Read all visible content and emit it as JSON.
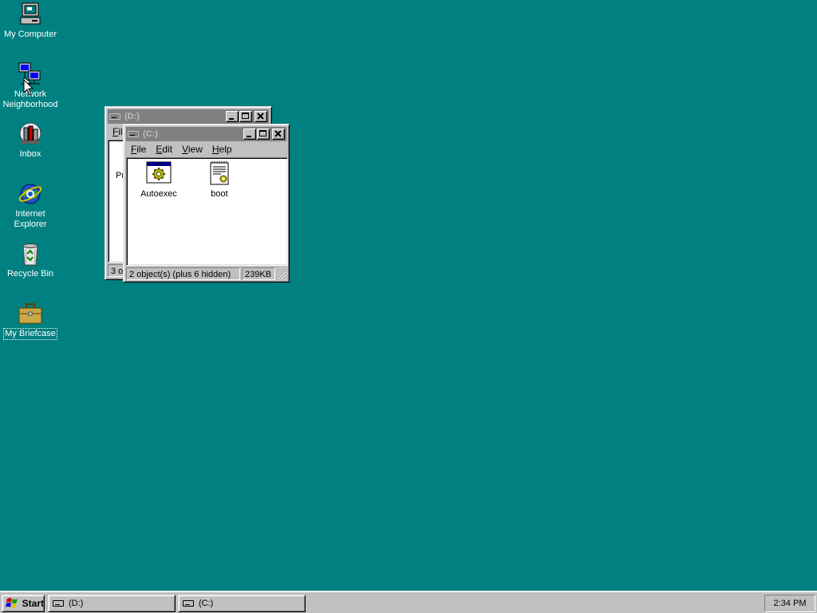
{
  "desktop": {
    "icons": [
      {
        "label": "My Computer"
      },
      {
        "label": "Network\nNeighborhood"
      },
      {
        "label": "Inbox"
      },
      {
        "label": "Internet\nExplorer"
      },
      {
        "label": "Recycle Bin"
      },
      {
        "label": "My Briefcase"
      }
    ]
  },
  "window_d": {
    "title": "(D:)",
    "menu_partial": "Fil",
    "content_partial": "Pr",
    "status_partial": "3 o"
  },
  "window_c": {
    "title": "(C:)",
    "menu": [
      "File",
      "Edit",
      "View",
      "Help"
    ],
    "files": [
      {
        "name": "Autoexec",
        "icon": "batch-file-icon"
      },
      {
        "name": "boot",
        "icon": "text-document-icon"
      }
    ],
    "status_objects": "2 object(s) (plus 6 hidden)",
    "status_size": "239KB"
  },
  "taskbar": {
    "start_label": "Start",
    "tasks": [
      {
        "label": "(D:)"
      },
      {
        "label": "(C:)"
      }
    ],
    "clock": "2:34 PM"
  },
  "colors": {
    "desktop": "#008080",
    "face": "#c0c0c0",
    "inactive_title": "#808080"
  }
}
